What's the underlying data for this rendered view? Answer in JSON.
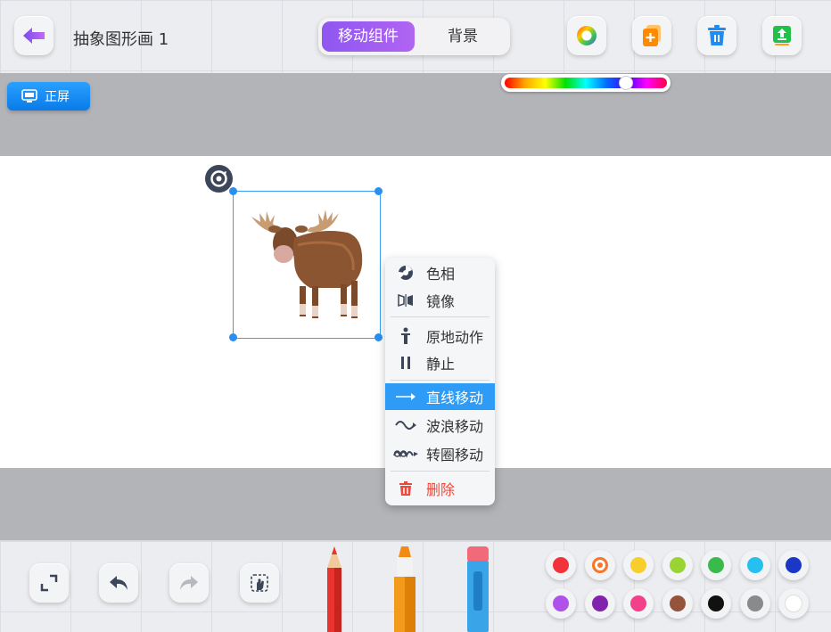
{
  "header": {
    "title": "抽象图形画 1",
    "tabs": [
      {
        "label": "移动组件",
        "active": true
      },
      {
        "label": "背景",
        "active": false
      }
    ]
  },
  "toolbar_icons": [
    "back-icon",
    "color-wheel-icon",
    "add-copy-icon",
    "trash-icon",
    "export-icon"
  ],
  "fullscreen": {
    "label": "正屏"
  },
  "hue_slider": {
    "value": 0.76
  },
  "context_menu": {
    "items": [
      {
        "label": "色相",
        "icon": "hue-icon"
      },
      {
        "label": "镜像",
        "icon": "mirror-icon"
      },
      {
        "label": "原地动作",
        "icon": "person-icon"
      },
      {
        "label": "静止",
        "icon": "pause-icon"
      },
      {
        "label": "直线移动",
        "icon": "arrow-right-icon",
        "active": true
      },
      {
        "label": "波浪移动",
        "icon": "wave-icon"
      },
      {
        "label": "转圈移动",
        "icon": "loop-icon"
      },
      {
        "label": "删除",
        "icon": "trash-icon",
        "danger": true
      }
    ]
  },
  "bottom_tools": [
    "expand-icon",
    "undo-icon",
    "redo-icon",
    "hand-pointer-icon"
  ],
  "drawing_tools": [
    "pencil",
    "marker",
    "eraser"
  ],
  "palette": {
    "colors": [
      "#f2333a",
      "#f7762a",
      "#f7ce2c",
      "#9ad334",
      "#3aba4b",
      "#25c0f0",
      "#1b37c6",
      "#b052ea",
      "#8223ad",
      "#f3408a",
      "#94533a",
      "#111111",
      "#8a8a8a",
      "#ffffff"
    ],
    "selected": "#f7762a"
  }
}
